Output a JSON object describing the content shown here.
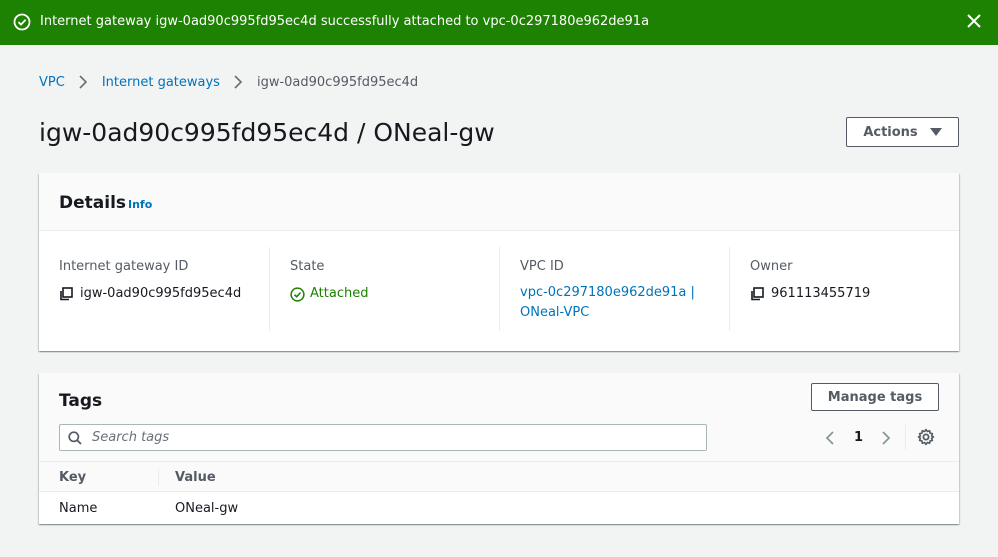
{
  "flash": {
    "message": "Internet gateway igw-0ad90c995fd95ec4d successfully attached to vpc-0c297180e962de91a",
    "color": "#1d8102",
    "icons": {
      "status": "check-circle-icon",
      "close": "close-icon"
    }
  },
  "breadcrumb": {
    "items": [
      "VPC",
      "Internet gateways"
    ],
    "current": "igw-0ad90c995fd95ec4d"
  },
  "page": {
    "title": "igw-0ad90c995fd95ec4d / ONeal-gw",
    "actions_label": "Actions"
  },
  "details": {
    "title": "Details",
    "info_label": "Info",
    "fields": {
      "gateway_id": {
        "label": "Internet gateway ID",
        "value": "igw-0ad90c995fd95ec4d"
      },
      "state": {
        "label": "State",
        "value": "Attached"
      },
      "vpc_id": {
        "label": "VPC ID",
        "value_line1": "vpc-0c297180e962de91a |",
        "value_line2": "ONeal-VPC"
      },
      "owner": {
        "label": "Owner",
        "value": "961113455719"
      }
    }
  },
  "tags": {
    "title": "Tags",
    "manage_label": "Manage tags",
    "search_placeholder": "Search tags",
    "page_number": "1",
    "columns": [
      "Key",
      "Value"
    ],
    "rows": [
      {
        "key": "Name",
        "value": "ONeal-gw"
      }
    ]
  },
  "colors": {
    "link": "#0073bb",
    "success": "#1d8102",
    "background": "#f2f3f3"
  }
}
